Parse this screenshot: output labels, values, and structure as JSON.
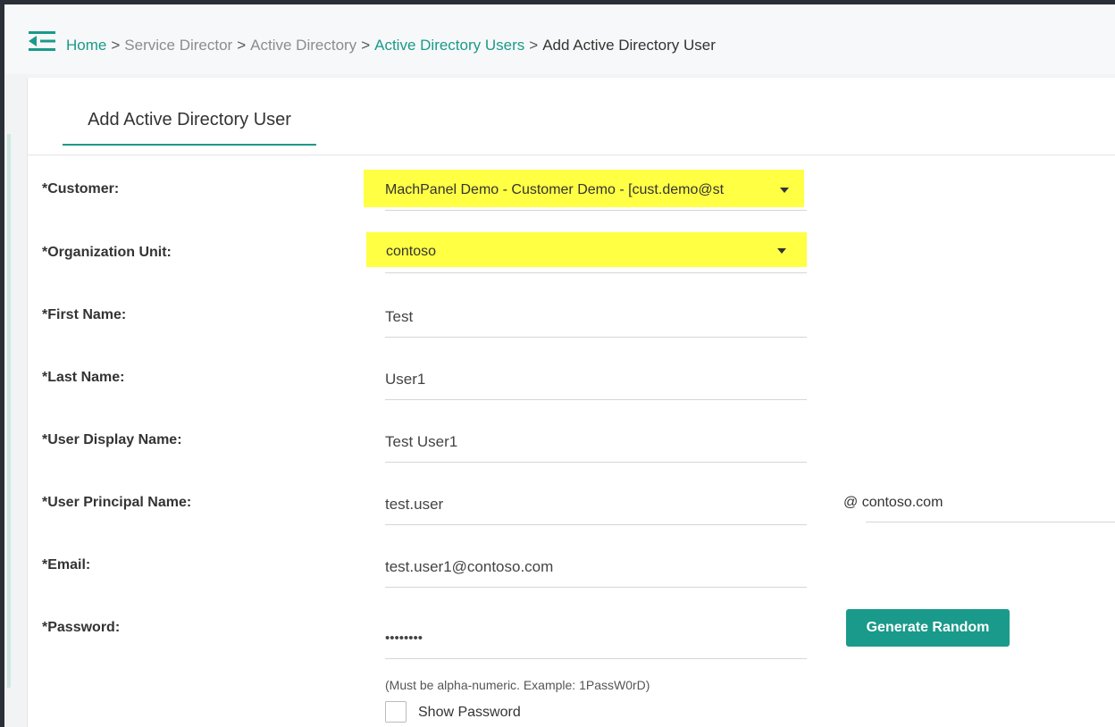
{
  "breadcrumb": {
    "home": "Home",
    "service_director": "Service Director",
    "active_directory": "Active Directory",
    "active_directory_users": "Active Directory Users",
    "current": "Add Active Directory User",
    "separator": ">"
  },
  "page": {
    "tab_title": "Add Active Directory User"
  },
  "form": {
    "customer": {
      "label": "*Customer:",
      "value": "MachPanel Demo - Customer Demo - [cust.demo@st"
    },
    "organization_unit": {
      "label": "*Organization Unit:",
      "value": "contoso"
    },
    "first_name": {
      "label": "*First Name:",
      "value": "Test"
    },
    "last_name": {
      "label": "*Last Name:",
      "value": "User1"
    },
    "display_name": {
      "label": "*User Display Name:",
      "value": "Test User1"
    },
    "principal_name": {
      "label": "*User Principal Name:",
      "value": "test.user",
      "domain": "@ contoso.com"
    },
    "email": {
      "label": "*Email:",
      "value": "test.user1@contoso.com"
    },
    "password": {
      "label": "*Password:",
      "value": "••••••••",
      "generate_label": "Generate Random",
      "hint": "(Must be alpha-numeric. Example: 1PassW0rD)",
      "show_password_label": "Show Password"
    }
  },
  "colors": {
    "accent": "#1a9a8a",
    "highlight": "#ffff44",
    "muted_link": "#8c8c8c"
  },
  "icons": {
    "menu": "menu-collapse-icon",
    "dropdown": "caret-down-icon"
  }
}
